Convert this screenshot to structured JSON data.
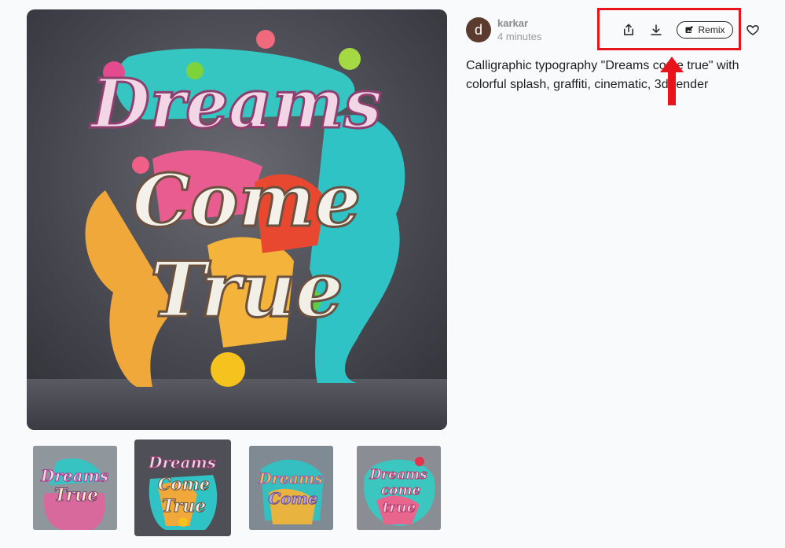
{
  "post": {
    "author_initial": "d",
    "username": "karkar",
    "timestamp": "4 minutes",
    "prompt": "Calligraphic typography \"Dreams come true\" with colorful splash, graffiti, cinematic, 3d render"
  },
  "image": {
    "main_text_lines": [
      "Dreams",
      "Come",
      "True"
    ]
  },
  "thumbnails": [
    {
      "text_lines": [
        "Dreams",
        "True"
      ],
      "selected": false
    },
    {
      "text_lines": [
        "Dreams",
        "Come",
        "True"
      ],
      "selected": true
    },
    {
      "text_lines": [
        "Dreams",
        "Come"
      ],
      "selected": false
    },
    {
      "text_lines": [
        "Dreams",
        "come",
        "true"
      ],
      "selected": false
    }
  ],
  "actions": {
    "share_icon": "share-icon",
    "download_icon": "download-icon",
    "remix_label": "Remix",
    "favorite_icon": "heart-icon"
  },
  "annotation": {
    "box_color": "#e8141c",
    "arrow_color": "#e8141c"
  }
}
